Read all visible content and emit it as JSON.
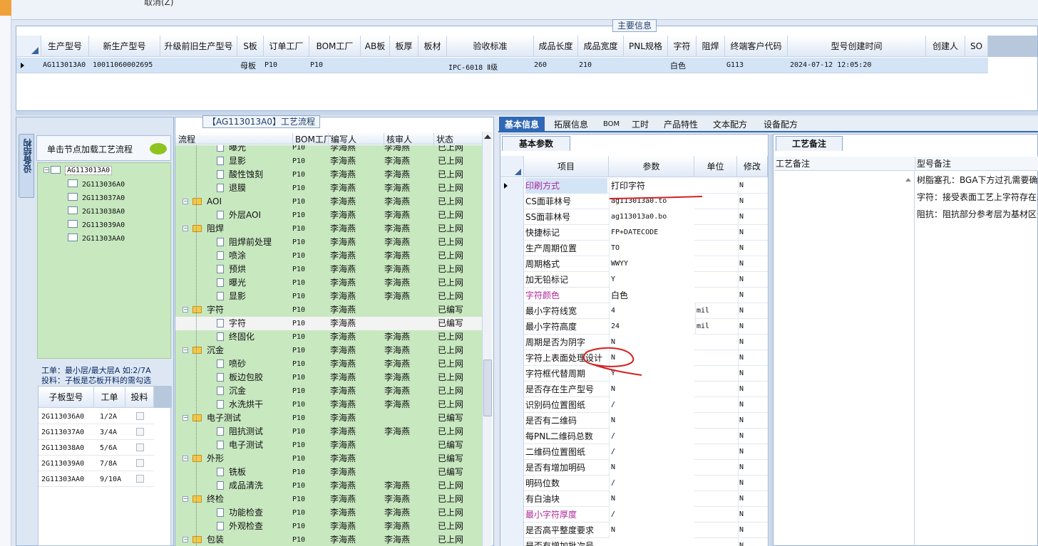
{
  "toolbar": {
    "cancel_label": "取消(Z)"
  },
  "main_info": {
    "title": "主要信息",
    "columns": [
      "生产型号",
      "新生产型号",
      "升级前旧生产型号",
      "S板",
      "订单工厂",
      "BOM工厂",
      "AB板",
      "板厚",
      "板材",
      "验收标准",
      "成品长度",
      "成品宽度",
      "PNL规格",
      "字符",
      "阻焊",
      "终端客户代码",
      "型号创建时间",
      "创建人",
      "SO"
    ],
    "row": {
      "生产型号": "AG113013A0",
      "新生产型号": "10011060002695",
      "S板": "母板",
      "订单工厂": "P10",
      "BOM工厂": "P10",
      "验收标准": "IPC-6018 Ⅱ级",
      "成品长度": "260",
      "成品宽度": "210",
      "字符": "白色",
      "终端客户代码": "G113",
      "型号创建时间": "2024-07-12 12:05:20"
    }
  },
  "left_panel": {
    "vertical_tab": "设备结构",
    "load_button": "单击节点加载工艺流程",
    "tree_root": "AG113013A0",
    "tree_children": [
      "2G113036A0",
      "2G113037A0",
      "2G113038A0",
      "2G113039A0",
      "2G11303AA0"
    ],
    "note_line1": "工单：最小层/最大层A 如:2/7A",
    "note_line2": "投料：子板是芯板开料的需勾选",
    "sub_table": {
      "headers": [
        "子板型号",
        "工单",
        "投料"
      ],
      "rows": [
        {
          "model": "2G113036A0",
          "order": "1/2A"
        },
        {
          "model": "2G113037A0",
          "order": "3/4A"
        },
        {
          "model": "2G113038A0",
          "order": "5/6A"
        },
        {
          "model": "2G113039A0",
          "order": "7/8A"
        },
        {
          "model": "2G11303AA0",
          "order": "9/10A"
        }
      ]
    }
  },
  "process_panel": {
    "title": "【AG113013A0】工艺流程",
    "headers": [
      "流程",
      "BOM工厂",
      "编写人",
      "核审人",
      "状态"
    ],
    "rows": [
      {
        "level": 2,
        "name": "曝光",
        "bom": "P10",
        "writer": "李海燕",
        "reviewer": "李海燕",
        "status": "已上网"
      },
      {
        "level": 2,
        "name": "显影",
        "bom": "P10",
        "writer": "李海燕",
        "reviewer": "李海燕",
        "status": "已上网"
      },
      {
        "level": 2,
        "name": "酸性蚀刻",
        "bom": "P10",
        "writer": "李海燕",
        "reviewer": "李海燕",
        "status": "已上网"
      },
      {
        "level": 2,
        "name": "退膜",
        "bom": "P10",
        "writer": "李海燕",
        "reviewer": "李海燕",
        "status": "已上网"
      },
      {
        "level": 1,
        "name": "AOI",
        "bom": "P10",
        "writer": "李海燕",
        "reviewer": "李海燕",
        "status": "已上网"
      },
      {
        "level": 2,
        "name": "外层AOI",
        "bom": "P10",
        "writer": "李海燕",
        "reviewer": "李海燕",
        "status": "已上网"
      },
      {
        "level": 1,
        "name": "阻焊",
        "bom": "P10",
        "writer": "李海燕",
        "reviewer": "李海燕",
        "status": "已上网"
      },
      {
        "level": 2,
        "name": "阻焊前处理",
        "bom": "P10",
        "writer": "李海燕",
        "reviewer": "李海燕",
        "status": "已上网"
      },
      {
        "level": 2,
        "name": "喷涂",
        "bom": "P10",
        "writer": "李海燕",
        "reviewer": "李海燕",
        "status": "已上网"
      },
      {
        "level": 2,
        "name": "预烘",
        "bom": "P10",
        "writer": "李海燕",
        "reviewer": "李海燕",
        "status": "已上网"
      },
      {
        "level": 2,
        "name": "曝光",
        "bom": "P10",
        "writer": "李海燕",
        "reviewer": "李海燕",
        "status": "已上网"
      },
      {
        "level": 2,
        "name": "显影",
        "bom": "P10",
        "writer": "李海燕",
        "reviewer": "李海燕",
        "status": "已上网"
      },
      {
        "level": 1,
        "name": "字符",
        "bom": "P10",
        "writer": "李海燕",
        "reviewer": "",
        "status": "已编写"
      },
      {
        "level": 2,
        "name": "字符",
        "bom": "P10",
        "writer": "李海燕",
        "reviewer": "",
        "status": "已编写",
        "selected": true
      },
      {
        "level": 2,
        "name": "终固化",
        "bom": "P10",
        "writer": "李海燕",
        "reviewer": "李海燕",
        "status": "已上网"
      },
      {
        "level": 1,
        "name": "沉金",
        "bom": "P10",
        "writer": "李海燕",
        "reviewer": "李海燕",
        "status": "已上网"
      },
      {
        "level": 2,
        "name": "喷砂",
        "bom": "P10",
        "writer": "李海燕",
        "reviewer": "李海燕",
        "status": "已上网"
      },
      {
        "level": 2,
        "name": "板边包胶",
        "bom": "P10",
        "writer": "李海燕",
        "reviewer": "李海燕",
        "status": "已上网"
      },
      {
        "level": 2,
        "name": "沉金",
        "bom": "P10",
        "writer": "李海燕",
        "reviewer": "李海燕",
        "status": "已上网"
      },
      {
        "level": 2,
        "name": "水洗烘干",
        "bom": "P10",
        "writer": "李海燕",
        "reviewer": "李海燕",
        "status": "已上网"
      },
      {
        "level": 1,
        "name": "电子测试",
        "bom": "P10",
        "writer": "李海燕",
        "reviewer": "",
        "status": "已编写"
      },
      {
        "level": 2,
        "name": "阻抗测试",
        "bom": "P10",
        "writer": "李海燕",
        "reviewer": "李海燕",
        "status": "已上网"
      },
      {
        "level": 2,
        "name": "电子测试",
        "bom": "P10",
        "writer": "李海燕",
        "reviewer": "",
        "status": "已编写"
      },
      {
        "level": 1,
        "name": "外形",
        "bom": "P10",
        "writer": "李海燕",
        "reviewer": "",
        "status": "已编写"
      },
      {
        "level": 2,
        "name": "铣板",
        "bom": "P10",
        "writer": "李海燕",
        "reviewer": "",
        "status": "已编写"
      },
      {
        "level": 2,
        "name": "成品清洗",
        "bom": "P10",
        "writer": "李海燕",
        "reviewer": "李海燕",
        "status": "已上网"
      },
      {
        "level": 1,
        "name": "终检",
        "bom": "P10",
        "writer": "李海燕",
        "reviewer": "李海燕",
        "status": "已上网"
      },
      {
        "level": 2,
        "name": "功能检查",
        "bom": "P10",
        "writer": "李海燕",
        "reviewer": "李海燕",
        "status": "已上网"
      },
      {
        "level": 2,
        "name": "外观检查",
        "bom": "P10",
        "writer": "李海燕",
        "reviewer": "李海燕",
        "status": "已上网"
      },
      {
        "level": 1,
        "name": "包装",
        "bom": "P10",
        "writer": "李海燕",
        "reviewer": "李海燕",
        "status": "已上网"
      }
    ]
  },
  "right_tabs": [
    "基本信息",
    "拓展信息",
    "BOM",
    "工时",
    "产品特性",
    "文本配方",
    "设备配方"
  ],
  "basic_params": {
    "title": "基本参数",
    "headers": [
      "项目",
      "参数",
      "单位",
      "修改"
    ],
    "rows": [
      {
        "item": "印刷方式",
        "param": "打印字符",
        "unit": "",
        "mod": "N",
        "highlight": true
      },
      {
        "item": "CS面菲林号",
        "param": "ag113013a0.to",
        "unit": "",
        "mod": "N"
      },
      {
        "item": "SS面菲林号",
        "param": "ag113013a0.bo",
        "unit": "",
        "mod": "N"
      },
      {
        "item": "快捷标记",
        "param": "FP+DATECODE",
        "unit": "",
        "mod": "N"
      },
      {
        "item": "生产周期位置",
        "param": "TO",
        "unit": "",
        "mod": "N"
      },
      {
        "item": "周期格式",
        "param": "WWYY",
        "unit": "",
        "mod": "N"
      },
      {
        "item": "加无铅标记",
        "param": "Y",
        "unit": "",
        "mod": "N"
      },
      {
        "item": "字符颜色",
        "param": "白色",
        "unit": "",
        "mod": "N",
        "highlight": true
      },
      {
        "item": "最小字符线宽",
        "param": "4",
        "unit": "mil",
        "mod": "N"
      },
      {
        "item": "最小字符高度",
        "param": "24",
        "unit": "mil",
        "mod": "N"
      },
      {
        "item": "周期是否为阴字",
        "param": "N",
        "unit": "",
        "mod": "N"
      },
      {
        "item": "字符上表面处理设计",
        "param": "N",
        "unit": "",
        "mod": "N"
      },
      {
        "item": "字符框代替周期",
        "param": "Y",
        "unit": "",
        "mod": "N"
      },
      {
        "item": "是否存在生产型号",
        "param": "N",
        "unit": "",
        "mod": "N"
      },
      {
        "item": "识别码位置图纸",
        "param": "/",
        "unit": "",
        "mod": "N"
      },
      {
        "item": "是否有二维码",
        "param": "N",
        "unit": "",
        "mod": "N"
      },
      {
        "item": "每PNL二维码总数",
        "param": "/",
        "unit": "",
        "mod": "N"
      },
      {
        "item": "二维码位置图纸",
        "param": "/",
        "unit": "",
        "mod": "N"
      },
      {
        "item": "是否有增加明码",
        "param": "N",
        "unit": "",
        "mod": "N"
      },
      {
        "item": "明码位数",
        "param": "/",
        "unit": "",
        "mod": "N"
      },
      {
        "item": "有白油块",
        "param": "N",
        "unit": "",
        "mod": "N"
      },
      {
        "item": "最小字符厚度",
        "param": "/",
        "unit": "",
        "mod": "N",
        "highlight": true
      },
      {
        "item": "是否高平整度要求",
        "param": "N",
        "unit": "",
        "mod": "N"
      },
      {
        "item": "是否有增加批次号",
        "param": "",
        "unit": "",
        "mod": "N"
      }
    ]
  },
  "process_notes": {
    "tab_title": "工艺备注",
    "col1": "工艺备注",
    "col2": "型号备注",
    "notes": [
      "树脂塞孔：BGA下方过孔需要确保",
      "字符：接受表面工艺上字符存在以",
      "阻抗：阻抗部分参考层为基材区"
    ]
  }
}
